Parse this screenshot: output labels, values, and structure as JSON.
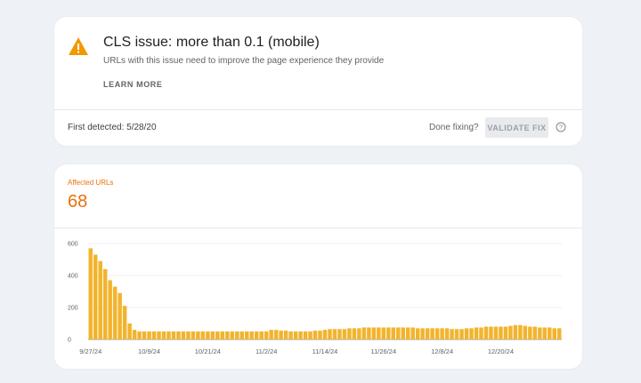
{
  "issue": {
    "title": "CLS issue: more than 0.1 (mobile)",
    "description": "URLs with this issue need to improve the page experience they provide",
    "learn_more": "LEARN MORE",
    "first_detected": "First detected: 5/28/20",
    "done_fixing": "Done fixing?",
    "validate_button": "VALIDATE FIX",
    "warning_icon": "warning-triangle-icon",
    "help_icon": "help-circle-icon"
  },
  "summary": {
    "label": "Affected URLs",
    "value": "68"
  },
  "colors": {
    "accent": "#e8710a",
    "bar": "#f2b42d",
    "warning": "#f29900"
  },
  "chart_data": {
    "type": "bar",
    "ylim": [
      0,
      600
    ],
    "yticks": [
      0,
      200,
      400,
      600
    ],
    "xtick_labels": [
      "9/27/24",
      "10/9/24",
      "10/21/24",
      "11/2/24",
      "11/14/24",
      "11/26/24",
      "12/8/24",
      "12/20/24"
    ],
    "xtick_indices": [
      0,
      12,
      24,
      36,
      48,
      60,
      72,
      84
    ],
    "grid": true,
    "values": [
      570,
      530,
      490,
      440,
      370,
      330,
      290,
      210,
      100,
      60,
      50,
      50,
      50,
      50,
      50,
      50,
      50,
      50,
      50,
      50,
      50,
      50,
      50,
      50,
      50,
      50,
      50,
      50,
      50,
      50,
      50,
      50,
      50,
      50,
      50,
      50,
      50,
      60,
      60,
      55,
      55,
      50,
      50,
      50,
      50,
      50,
      55,
      55,
      60,
      65,
      65,
      65,
      65,
      70,
      70,
      70,
      75,
      75,
      75,
      75,
      75,
      75,
      75,
      75,
      75,
      75,
      75,
      70,
      70,
      70,
      70,
      70,
      70,
      70,
      65,
      65,
      65,
      70,
      70,
      75,
      75,
      80,
      80,
      80,
      80,
      80,
      85,
      90,
      90,
      85,
      80,
      80,
      75,
      75,
      75,
      70,
      70
    ]
  }
}
